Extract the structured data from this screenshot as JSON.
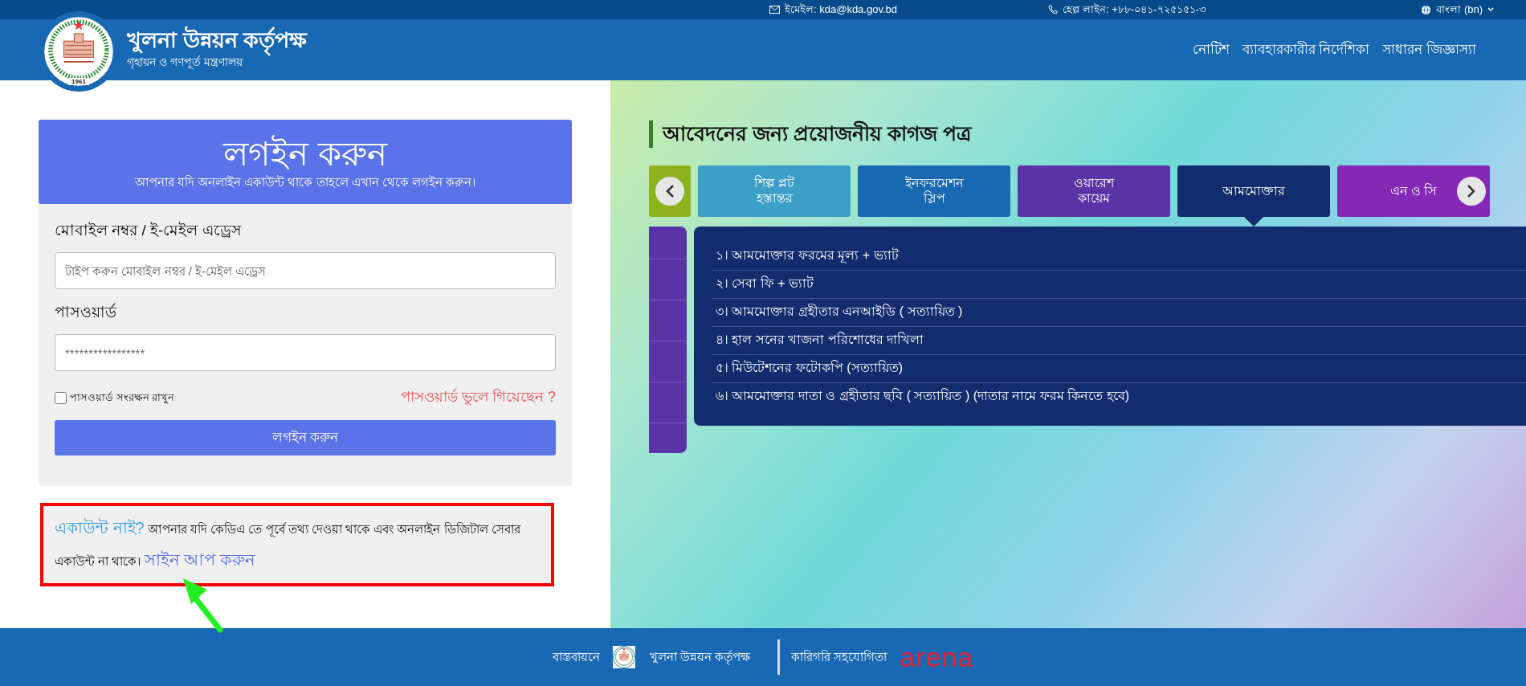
{
  "top_bar": {
    "email": "ইমেইল: kda@kda.gov.bd",
    "helpline": "হেল্প লাইন: +৮৮-০৪১-৭২৫১৫১-৩",
    "language": "বাংলা (bn)"
  },
  "header": {
    "title": "খুলনা উন্নয়ন কর্তৃপক্ষ",
    "subtitle": "গৃহায়ন ও গণপূর্ত মন্ত্রণালয়",
    "logo_year": "1961",
    "nav": [
      "নোটিশ",
      "ব্যাবহারকারীর নির্দেশিকা",
      "সাধারন জিজ্ঞাস্যা"
    ]
  },
  "login": {
    "title": "লগইন করুন",
    "subtitle": "আপনার যদি অনলাইন একাউন্ট থাকে তাহলে এখান থেকে লগইন করুন।",
    "fields": [
      {
        "label": "মোবাইল নম্বর / ই-মেইল এড্রেস",
        "placeholder": "টাইপ করুন মোবাইল নম্বর / ই-মেইল এড্রেস"
      },
      {
        "label": "পাসওয়ার্ড",
        "placeholder": "*****************"
      }
    ],
    "remember": {
      "label": "পাসওয়ার্ড সংরক্ষন রাখুন",
      "checked": false
    },
    "forgot": "পাসওয়ার্ড ভুলে গিয়েছেন ?",
    "submit": "লগইন করুন"
  },
  "signup": {
    "lead": "একাউন্ট নাই?",
    "text": " আপনার যদি কেডিএ তে পূর্বে তথ্য দেওয়া থাকে এবং অনলাইন ডিজিটাল সেবার একাউন্ট না থাকে। ",
    "link": "সাইন আপ করুন"
  },
  "documents": {
    "title": "আবেদনের জন্য প্রয়োজনীয় কাগজ পত্র",
    "tabs": [
      {
        "color": "#8db21e",
        "selected": false
      },
      {
        "label": "শিল্প প্লট\nহস্তান্তর",
        "color": "#3c9fc8",
        "selected": false
      },
      {
        "label": "ইনফরমেশন\nস্লিপ",
        "color": "#1868b4",
        "selected": false
      },
      {
        "label": "ওয়ারেশ\nকায়েম",
        "color": "#5a34a6",
        "selected": false
      },
      {
        "label": "আমমোক্তার",
        "color": "#132c6e",
        "selected": true
      },
      {
        "label": "এন ও সি",
        "color": "#8429b6",
        "selected": false
      }
    ],
    "items": [
      "১। আমমোক্তার ফরমের মূল্য + ভ্যাট",
      "২। সেবা ফি + ভ্যাট",
      "৩। আমমোক্তার গ্রহীতার এনআইডি ( সত্যায়িত )",
      "৪। হাল সনের খাজনা পরিশোধের দাখিলা",
      "৫। মিউটেশনের ফটোকপি (সত্যায়িত)",
      "৬। আমমোক্তার দাতা ও গ্রহীতার ছবি ( সত্যায়িত )  (দাতার নামে ফরম কিনতে হবে)"
    ]
  },
  "footer": {
    "implemented_by": "বাস্তবায়নে",
    "org": "খুলনা উন্নয়ন কর্তৃপক্ষ",
    "tech_support": "কারিগরি সহযোগিতা",
    "partner": "arena"
  }
}
